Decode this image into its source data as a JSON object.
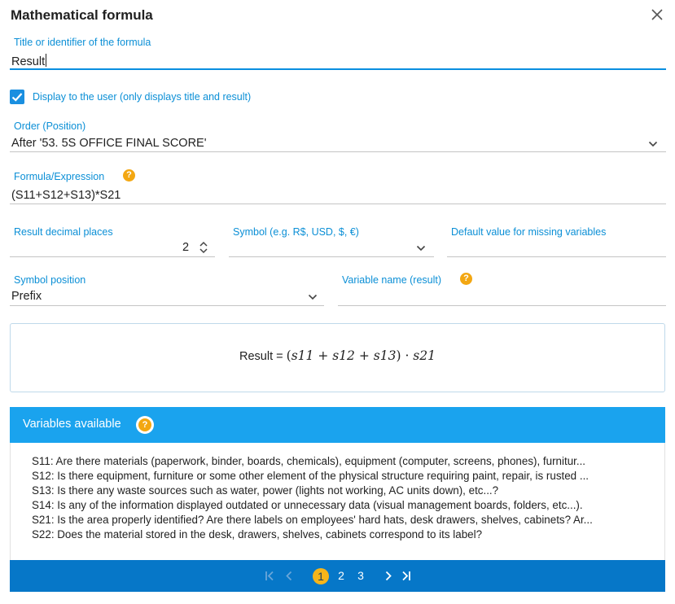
{
  "dialog": {
    "title": "Mathematical formula",
    "close_icon": "close-icon"
  },
  "fields": {
    "title_label": "Title or identifier of the formula",
    "title_value": "Result",
    "display_checkbox_label": "Display to the user (only displays title and result)",
    "display_checked": true,
    "order_label": "Order (Position)",
    "order_value": "After '53. 5S OFFICE FINAL SCORE'",
    "formula_label": "Formula/Expression",
    "formula_value": "(S11+S12+S13)*S21",
    "decimal_label": "Result decimal places",
    "decimal_value": "2",
    "symbol_label": "Symbol (e.g. R$, USD, $, €)",
    "symbol_value": "",
    "default_label": "Default value for missing variables",
    "default_value": "",
    "symbol_position_label": "Symbol position",
    "symbol_position_value": "Prefix",
    "variable_name_label": "Variable name (result)",
    "variable_name_value": ""
  },
  "preview": {
    "prefix": "Result = ",
    "math": {
      "open": "(",
      "t1": "s11",
      "plus1": " + ",
      "t2": "s12",
      "plus2": " + ",
      "t3": "s13",
      "close": ")",
      "dot": " · ",
      "t4": "s21"
    }
  },
  "variables": {
    "title": "Variables available",
    "items": [
      "S11: Are there materials (paperwork, binder, boards, chemicals), equipment (computer, screens, phones), furnitur...",
      "S12: Is there equipment, furniture or some other element of the physical structure requiring paint, repair, is rusted ...",
      "S13: Is there any waste sources such as water, power (lights not working, AC units down), etc...?",
      "S14: Is any of the information displayed outdated or unnecessary data (visual management boards, folders, etc...).",
      "S21: Is the area properly identified? Are there labels on employees' hard hats, desk drawers, shelves, cabinets? Ar...",
      "S22: Does the material stored in the desk, drawers, shelves, cabinets correspond to its label?"
    ]
  },
  "pagination": {
    "first": "|<",
    "prev": "<",
    "pages": [
      "1",
      "2",
      "3"
    ],
    "current": "1",
    "next": ">",
    "last": ">|"
  },
  "colors": {
    "accent": "#0b8fd6",
    "header_blue": "#1aa3ee",
    "pager_blue": "#0677c8",
    "help_orange": "#f3a712",
    "current_page": "#f6b51a"
  }
}
